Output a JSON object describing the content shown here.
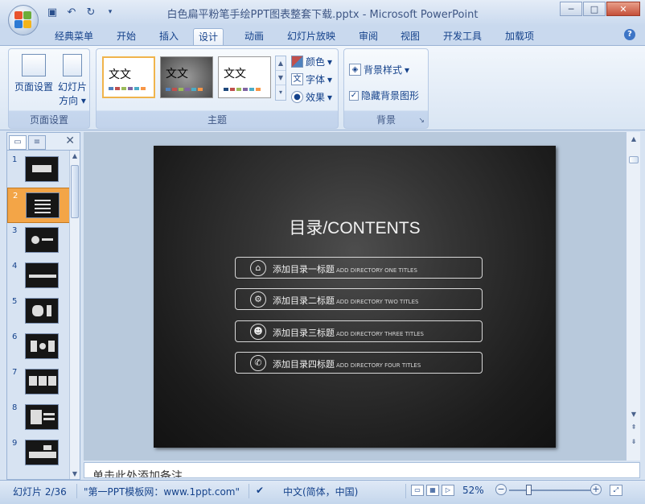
{
  "window": {
    "title": "白色扁平粉笔手绘PPT图表整套下载.pptx - Microsoft PowerPoint",
    "controls": [
      "minimize",
      "maximize",
      "close"
    ]
  },
  "quick_access": [
    "save-icon",
    "undo-icon",
    "redo-icon",
    "customize-icon"
  ],
  "tabs": [
    {
      "label": "经典菜单"
    },
    {
      "label": "开始"
    },
    {
      "label": "插入"
    },
    {
      "label": "设计",
      "active": true
    },
    {
      "label": "动画"
    },
    {
      "label": "幻灯片放映"
    },
    {
      "label": "审阅"
    },
    {
      "label": "视图"
    },
    {
      "label": "开发工具"
    },
    {
      "label": "加载项"
    }
  ],
  "ribbon": {
    "page_setup": {
      "label": "页面设置",
      "page_setup_btn": "页面设置",
      "orientation_btn_line1": "幻灯片",
      "orientation_btn_line2": "方向"
    },
    "themes": {
      "label": "主题",
      "items": [
        {
          "text": "文文",
          "selected": true
        },
        {
          "text": "文文",
          "selected": false
        },
        {
          "text": "文文",
          "selected": false
        }
      ],
      "colors_btn": "颜色",
      "fonts_btn": "字体",
      "effects_btn": "效果"
    },
    "background": {
      "label": "背景",
      "styles_btn": "背景样式",
      "hide_graphics": "隐藏背景图形",
      "hide_graphics_checked": true
    }
  },
  "slide_panel": {
    "slides": [
      "1",
      "2",
      "3",
      "4",
      "5",
      "6",
      "7",
      "8",
      "9"
    ],
    "active_slide": "2"
  },
  "slide": {
    "title": "目录/CONTENTS",
    "items": [
      {
        "icon": "home-icon",
        "glyph": "⌂",
        "cn": "添加目录一标题",
        "en": "ADD DIRECTORY ONE TITLES"
      },
      {
        "icon": "gears-icon",
        "glyph": "⚙",
        "cn": "添加目录二标题",
        "en": "ADD DIRECTORY TWO TITLES"
      },
      {
        "icon": "people-icon",
        "glyph": "☻",
        "cn": "添加目录三标题",
        "en": "ADD DIRECTORY THREE TITLES"
      },
      {
        "icon": "phone-icon",
        "glyph": "✆",
        "cn": "添加目录四标题",
        "en": "ADD DIRECTORY FOUR TITLES"
      }
    ]
  },
  "notes": {
    "placeholder": "单击此处添加备注"
  },
  "status": {
    "slide_counter": "幻灯片 2/36",
    "theme_name": "\"第一PPT模板网：www.1ppt.com\"",
    "language": "中文(简体，中国)",
    "zoom": "52%"
  },
  "colors": {
    "accent": "#15428b",
    "ribbon_bg": "#d9e5f3",
    "slide_bg": "#2a2a2a",
    "active_thumb": "#f3a547"
  }
}
